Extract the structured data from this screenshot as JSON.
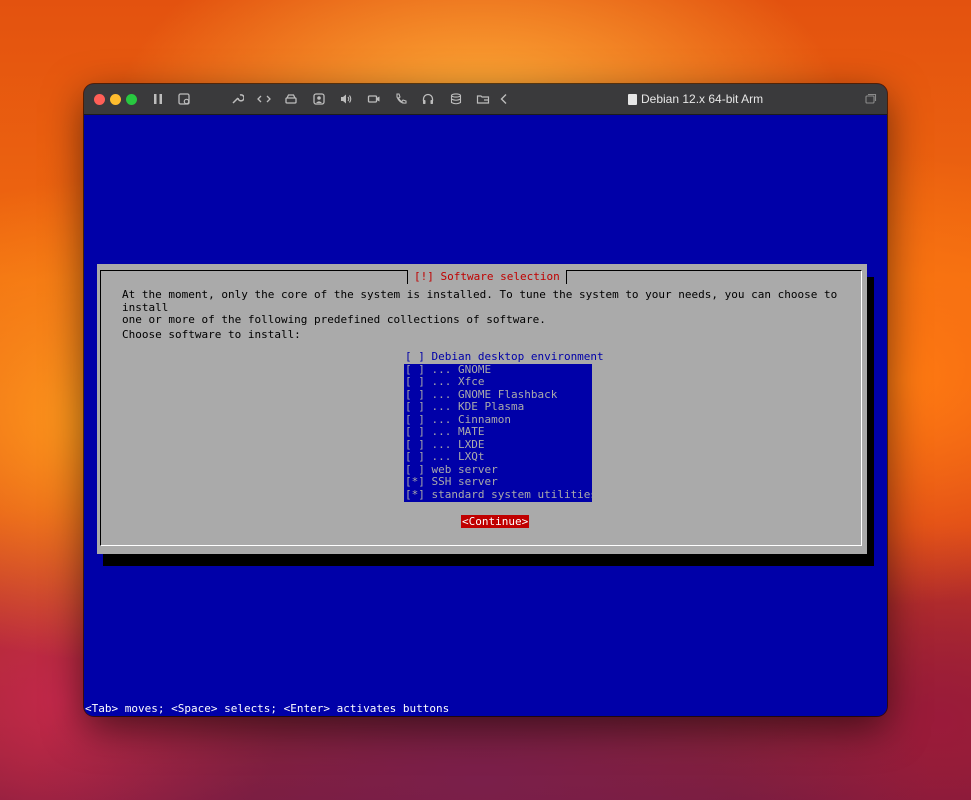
{
  "window": {
    "title": "Debian 12.x 64-bit Arm"
  },
  "toolbar": {
    "icons": [
      "pause-icon",
      "snapshot-icon",
      "settings-wrench-icon",
      "code-icon",
      "disk-icon",
      "user-account-icon",
      "volume-icon",
      "camera-icon",
      "phone-icon",
      "headphones-icon",
      "storage-icon",
      "shared-folder-icon",
      "back-chevron-icon",
      "fullscreen-icon"
    ]
  },
  "installer": {
    "dialog_title": "[!] Software selection",
    "intro_line1": "At the moment, only the core of the system is installed. To tune the system to your needs, you can choose to install",
    "intro_line2": "one or more of the following predefined collections of software.",
    "prompt": "Choose software to install:",
    "items": [
      {
        "label": "[ ] Debian desktop environment"
      },
      {
        "label": "[ ] ... GNOME"
      },
      {
        "label": "[ ] ... Xfce"
      },
      {
        "label": "[ ] ... GNOME Flashback"
      },
      {
        "label": "[ ] ... KDE Plasma"
      },
      {
        "label": "[ ] ... Cinnamon"
      },
      {
        "label": "[ ] ... MATE"
      },
      {
        "label": "[ ] ... LXDE"
      },
      {
        "label": "[ ] ... LXQt"
      },
      {
        "label": "[ ] web server"
      },
      {
        "label": "[*] SSH server"
      },
      {
        "label": "[*] standard system utilities"
      }
    ],
    "continue_label": "<Continue>",
    "footer_help": "<Tab> moves; <Space> selects; <Enter> activates buttons"
  },
  "colors": {
    "screen_bg": "#0000a8",
    "dialog_bg": "#aaaaaa",
    "accent_red": "#c00000"
  }
}
